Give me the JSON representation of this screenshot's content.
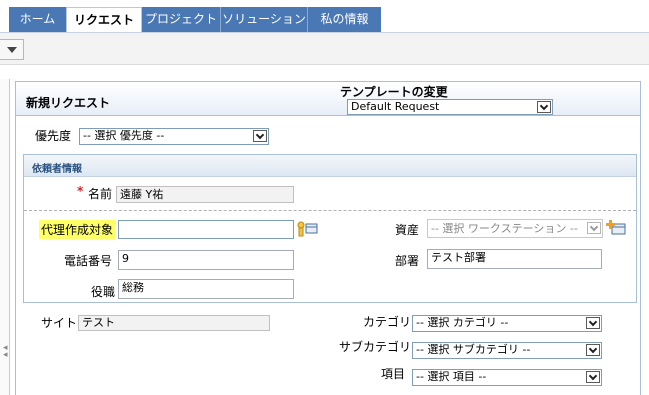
{
  "nav": {
    "tabs": [
      {
        "label": "ホーム"
      },
      {
        "label": "リクエスト"
      },
      {
        "label": "プロジェクト"
      },
      {
        "label": "ソリューション"
      },
      {
        "label": "私の情報"
      }
    ]
  },
  "panel": {
    "title": "新規リクエスト",
    "template_label": "テンプレートの変更",
    "template_value": "Default Request"
  },
  "priority": {
    "label": "優先度",
    "value": "-- 選択 優先度 --"
  },
  "requester": {
    "section_title": "依頼者情報",
    "required_marker": "*",
    "name_label": "名前",
    "name_value": "遠藤 Y祐",
    "proxy_label": "代理作成対象",
    "proxy_value": "",
    "asset_label": "資産",
    "asset_value": "-- 選択 ワークステーション --",
    "phone_label": "電話番号",
    "phone_value": "9",
    "dept_label": "部署",
    "dept_value": "テスト部署",
    "title_label": "役職",
    "title_value": "総務"
  },
  "details": {
    "site_label": "サイト",
    "site_value": "テスト",
    "category_label": "カテゴリ",
    "category_value": "-- 選択 カテゴリ --",
    "subcategory_label": "サブカテゴリ",
    "subcategory_value": "-- 選択 サブカテゴリ --",
    "item_label": "項目",
    "item_value": "-- 選択 項目 --"
  },
  "colors": {
    "tab_bg": "#4a78b4",
    "section_title": "#2b5381",
    "highlight": "#ffff66",
    "required": "#e02020"
  }
}
